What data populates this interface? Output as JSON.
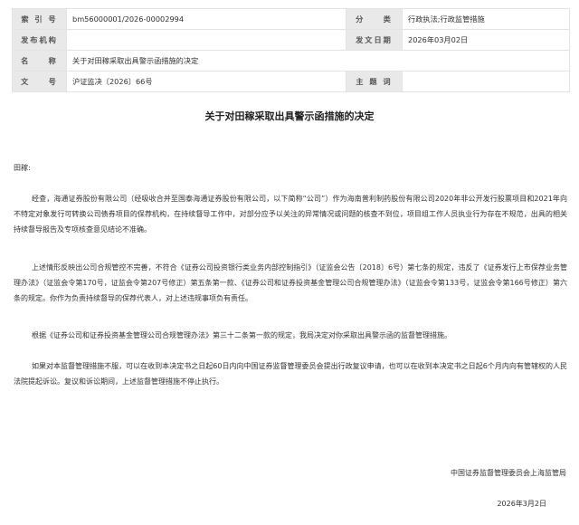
{
  "meta": {
    "rows": [
      {
        "k1": "索 引 号",
        "v1": "bm56000001/2026-00002994",
        "k2": "分　　类",
        "v2": "行政执法;行政监管措施"
      },
      {
        "k1": "发布机构",
        "v1": "",
        "k2": "发文日期",
        "v2": "2026年03月02日"
      },
      {
        "k1": "名　　称",
        "v1": "关于对田稼采取出具警示函措施的决定"
      },
      {
        "k1": "文　　号",
        "v1": "沪证监决〔2026〕66号",
        "k2": "主 题 词",
        "v2": ""
      }
    ]
  },
  "doc": {
    "title": "关于对田稼采取出具警示函措施的决定",
    "salutation": "田稼:",
    "paragraphs": [
      "经查，海通证券股份有限公司（经吸收合并至国泰海通证券股份有限公司，以下简称“公司”）作为海南普利制药股份有限公司2020年非公开发行股票项目和2021年向不特定对象发行可转换公司债券项目的保荐机构，在持续督导工作中，对部分应予以关注的异常情况或问题的核查不到位，项目组工作人员执业行为存在不规范，出具的相关持续督导报告及专项核查意见结论不准确。",
      "上述情形反映出公司合规管控不完善，不符合《证券公司投资银行类业务内部控制指引》（证监会公告〔2018〕6号）第七条的规定，违反了《证券发行上市保荐业务管理办法》（证监会令第170号，证监会令第207号修正）第五条第一款、《证券公司和证券投资基金管理公司合规管理办法》（证监会令第133号，证监会令第166号修正）第六条的规定。你作为负责持续督导的保荐代表人，对上述违规事项负有责任。",
      "根据《证券公司和证券投资基金管理公司合规管理办法》第三十二条第一款的规定，我局决定对你采取出具警示函的监督管理措施。",
      "如果对本监督管理措施不服，可以在收到本决定书之日起60日内向中国证券监督管理委员会提出行政复议申请，也可以在收到本决定书之日起6个月内向有管辖权的人民法院提起诉讼。复议和诉讼期间，上述监督管理措施不停止执行。"
    ],
    "issuer": "中国证券监督管理委员会上海监管局",
    "date": "2026年3月2日"
  }
}
